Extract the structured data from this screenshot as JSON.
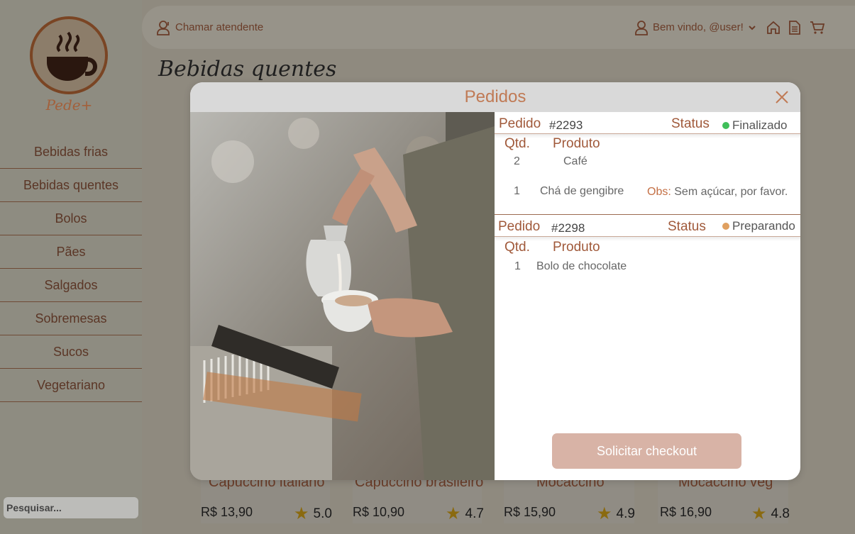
{
  "sidebar": {
    "logo_text": "Pede+",
    "items": [
      {
        "label": "Bebidas frias"
      },
      {
        "label": "Bebidas quentes"
      },
      {
        "label": "Bolos"
      },
      {
        "label": "Pães"
      },
      {
        "label": "Salgados"
      },
      {
        "label": "Sobremesas"
      },
      {
        "label": "Sucos"
      },
      {
        "label": "Vegetariano"
      }
    ],
    "search_placeholder": "Pesquisar..."
  },
  "topbar": {
    "call_attendant": "Chamar atendente",
    "welcome": "Bem vindo, @user!",
    "icons": [
      "user-icon",
      "chevron-down-icon",
      "home-icon",
      "document-icon",
      "cart-icon"
    ]
  },
  "page": {
    "title": "Bebidas quentes",
    "products": [
      {
        "name": "Capuccino italiano",
        "price": "R$ 13,90",
        "rating": "5.0"
      },
      {
        "name": "Capuccino brasileiro",
        "price": "R$ 10,90",
        "rating": "4.7"
      },
      {
        "name": "Mocaccino",
        "price": "R$ 15,90",
        "rating": "4.9"
      },
      {
        "name": "Mocaccino veg",
        "price": "R$ 16,90",
        "rating": "4.8"
      }
    ]
  },
  "modal": {
    "title": "Pedidos",
    "orders": [
      {
        "order_label": "Pedido",
        "number": "#2293",
        "status_label": "Status",
        "status": "Finalizado",
        "status_color": "#3fbf5a",
        "qty_header": "Qtd.",
        "product_header": "Produto",
        "items": [
          {
            "qty": "2",
            "product": "Café"
          },
          {
            "qty": "1",
            "product": "Chá de gengibre",
            "obs_label": "Obs:",
            "obs": "Sem açúcar, por favor."
          }
        ]
      },
      {
        "order_label": "Pedido",
        "number": "#2298",
        "status_label": "Status",
        "status": "Preparando",
        "status_color": "#e0a060",
        "qty_header": "Qtd.",
        "product_header": "Produto",
        "items": [
          {
            "qty": "1",
            "product": "Bolo de chocolate"
          }
        ]
      }
    ],
    "checkout_label": "Solicitar checkout"
  },
  "colors": {
    "accent": "#a0593a",
    "brown_dark": "#5b3626",
    "checkout_bg": "#d8b3a6"
  }
}
